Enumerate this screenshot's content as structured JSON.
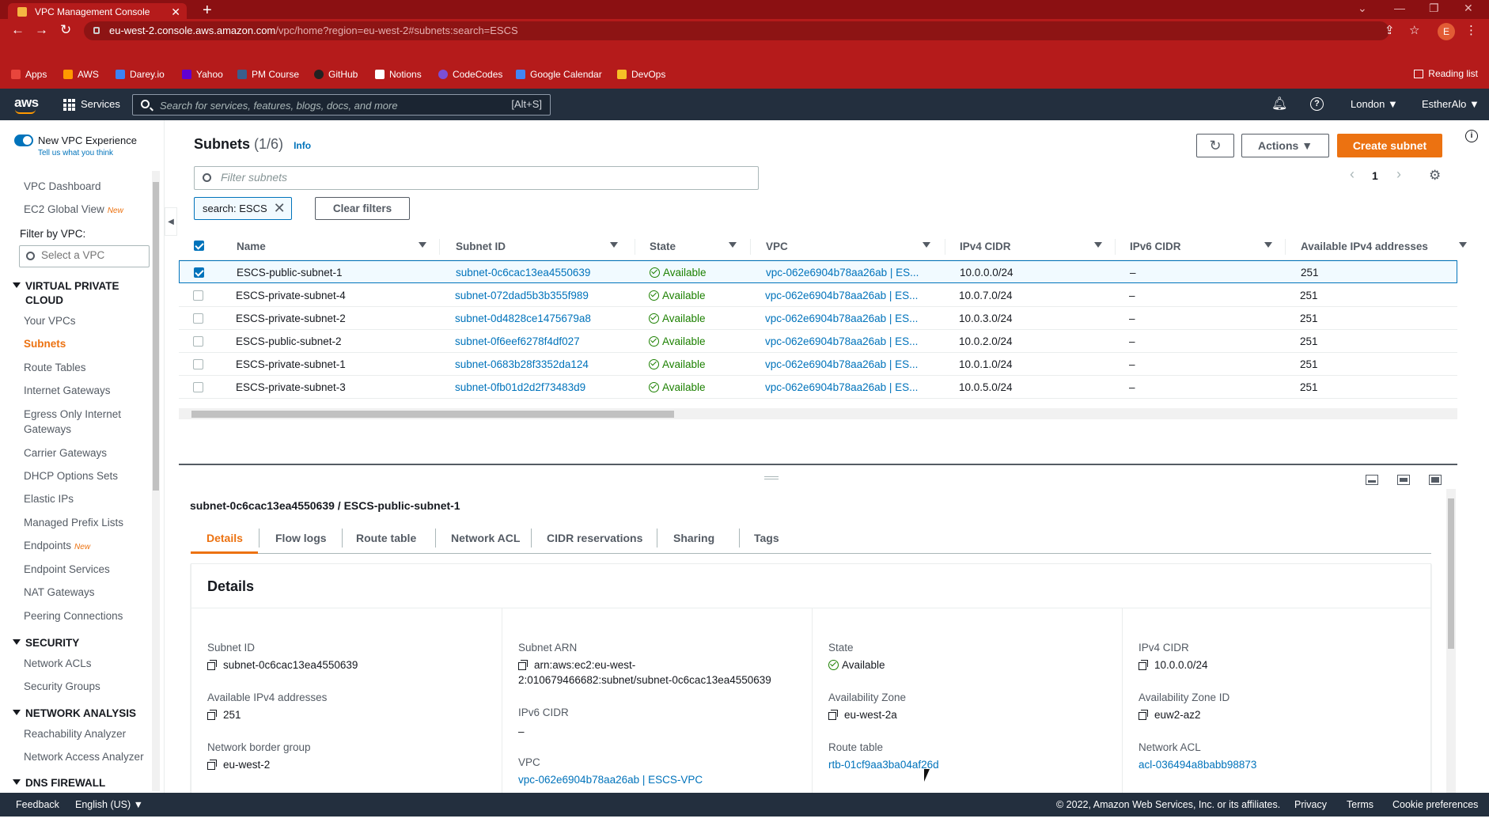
{
  "browser": {
    "tab_title": "VPC Management Console",
    "url_host": "eu-west-2.console.aws.amazon.com",
    "url_path": "/vpc/home?region=eu-west-2#subnets:search=ESCS",
    "profile_initial": "E",
    "bookmarks": [
      {
        "label": "Apps",
        "color": "#e8453c"
      },
      {
        "label": "AWS",
        "color": "#ff9900"
      },
      {
        "label": "Darey.io",
        "color": "#3b82f6"
      },
      {
        "label": "Yahoo",
        "color": "#6001d2"
      },
      {
        "label": "PM Course",
        "color": "#3a5e8c"
      },
      {
        "label": "GitHub",
        "color": "#222222"
      },
      {
        "label": "Notions",
        "color": "#ffffff"
      },
      {
        "label": "CodeCodes",
        "color": "#7b4fd6"
      },
      {
        "label": "Google Calendar",
        "color": "#4285f4"
      },
      {
        "label": "DevOps",
        "color": "#f6c026"
      }
    ],
    "reading_list": "Reading list"
  },
  "aws_nav": {
    "logo": "aws",
    "services": "Services",
    "search_placeholder": "Search for services, features, blogs, docs, and more",
    "search_shortcut": "[Alt+S]",
    "region": "London ▼",
    "account": "EstherAlo ▼"
  },
  "sidebar": {
    "new_vpc_experience": "New VPC Experience",
    "tell_us": "Tell us what you think",
    "vpc_dashboard": "VPC Dashboard",
    "ec2_global_view": "EC2 Global View",
    "new_badge": "New",
    "filter_label": "Filter by VPC:",
    "vpc_select_placeholder": "Select a VPC",
    "section_vpc": "VIRTUAL PRIVATE",
    "section_vpc_2": "CLOUD",
    "items_vpc": [
      "Your VPCs",
      "Subnets",
      "Route Tables",
      "Internet Gateways",
      "Egress Only Internet",
      "Gateways",
      "Carrier Gateways",
      "DHCP Options Sets",
      "Elastic IPs",
      "Managed Prefix Lists",
      "Endpoints",
      "Endpoint Services",
      "NAT Gateways",
      "Peering Connections"
    ],
    "section_security": "SECURITY",
    "items_security": [
      "Network ACLs",
      "Security Groups"
    ],
    "section_network_analysis": "NETWORK ANALYSIS",
    "items_network_analysis": [
      "Reachability Analyzer",
      "Network Access Analyzer"
    ],
    "section_dns_firewall": "DNS FIREWALL"
  },
  "subnets": {
    "title": "Subnets",
    "count": "(1/6)",
    "info": "Info",
    "actions": "Actions",
    "create": "Create subnet",
    "filter_placeholder": "Filter subnets",
    "page": "1",
    "token": "search: ESCS",
    "clear_filters": "Clear filters",
    "columns": [
      "Name",
      "Subnet ID",
      "State",
      "VPC",
      "IPv4 CIDR",
      "IPv6 CIDR",
      "Available IPv4 addresses"
    ],
    "rows": [
      {
        "name": "ESCS-public-subnet-1",
        "id": "subnet-0c6cac13ea4550639",
        "state": "Available",
        "vpc": "vpc-062e6904b78aa26ab | ES...",
        "ipv4": "10.0.0.0/24",
        "ipv6": "–",
        "avail": "251",
        "selected": true
      },
      {
        "name": "ESCS-private-subnet-4",
        "id": "subnet-072dad5b3b355f989",
        "state": "Available",
        "vpc": "vpc-062e6904b78aa26ab | ES...",
        "ipv4": "10.0.7.0/24",
        "ipv6": "–",
        "avail": "251",
        "selected": false
      },
      {
        "name": "ESCS-private-subnet-2",
        "id": "subnet-0d4828ce1475679a8",
        "state": "Available",
        "vpc": "vpc-062e6904b78aa26ab | ES...",
        "ipv4": "10.0.3.0/24",
        "ipv6": "–",
        "avail": "251",
        "selected": false
      },
      {
        "name": "ESCS-public-subnet-2",
        "id": "subnet-0f6eef6278f4df027",
        "state": "Available",
        "vpc": "vpc-062e6904b78aa26ab | ES...",
        "ipv4": "10.0.2.0/24",
        "ipv6": "–",
        "avail": "251",
        "selected": false
      },
      {
        "name": "ESCS-private-subnet-1",
        "id": "subnet-0683b28f3352da124",
        "state": "Available",
        "vpc": "vpc-062e6904b78aa26ab | ES...",
        "ipv4": "10.0.1.0/24",
        "ipv6": "–",
        "avail": "251",
        "selected": false
      },
      {
        "name": "ESCS-private-subnet-3",
        "id": "subnet-0fb01d2d2f73483d9",
        "state": "Available",
        "vpc": "vpc-062e6904b78aa26ab | ES...",
        "ipv4": "10.0.5.0/24",
        "ipv6": "–",
        "avail": "251",
        "selected": false
      }
    ]
  },
  "detail": {
    "title": "subnet-0c6cac13ea4550639 / ESCS-public-subnet-1",
    "tabs": [
      "Details",
      "Flow logs",
      "Route table",
      "Network ACL",
      "CIDR reservations",
      "Sharing",
      "Tags"
    ],
    "heading": "Details",
    "subnet_id_label": "Subnet ID",
    "subnet_id": "subnet-0c6cac13ea4550639",
    "avail_label": "Available IPv4 addresses",
    "avail": "251",
    "nbg_label": "Network border group",
    "nbg": "eu-west-2",
    "arn_label": "Subnet ARN",
    "arn_1": "arn:aws:ec2:eu-west-",
    "arn_2": "2:010679466682:subnet/subnet-0c6cac13ea4550639",
    "ipv6_label": "IPv6 CIDR",
    "ipv6": "–",
    "vpc_label": "VPC",
    "vpc": "vpc-062e6904b78aa26ab | ESCS-VPC",
    "state_label": "State",
    "state": "Available",
    "az_label": "Availability Zone",
    "az": "eu-west-2a",
    "rt_label": "Route table",
    "rt": "rtb-01cf9aa3ba04af26d",
    "ipv4_label": "IPv4 CIDR",
    "ipv4": "10.0.0.0/24",
    "azid_label": "Availability Zone ID",
    "azid": "euw2-az2",
    "nacl_label": "Network ACL",
    "nacl": "acl-036494a8babb98873"
  },
  "footer": {
    "feedback": "Feedback",
    "language": "English (US) ▼",
    "copyright": "© 2022, Amazon Web Services, Inc. or its affiliates.",
    "privacy": "Privacy",
    "terms": "Terms",
    "cookies": "Cookie preferences"
  }
}
